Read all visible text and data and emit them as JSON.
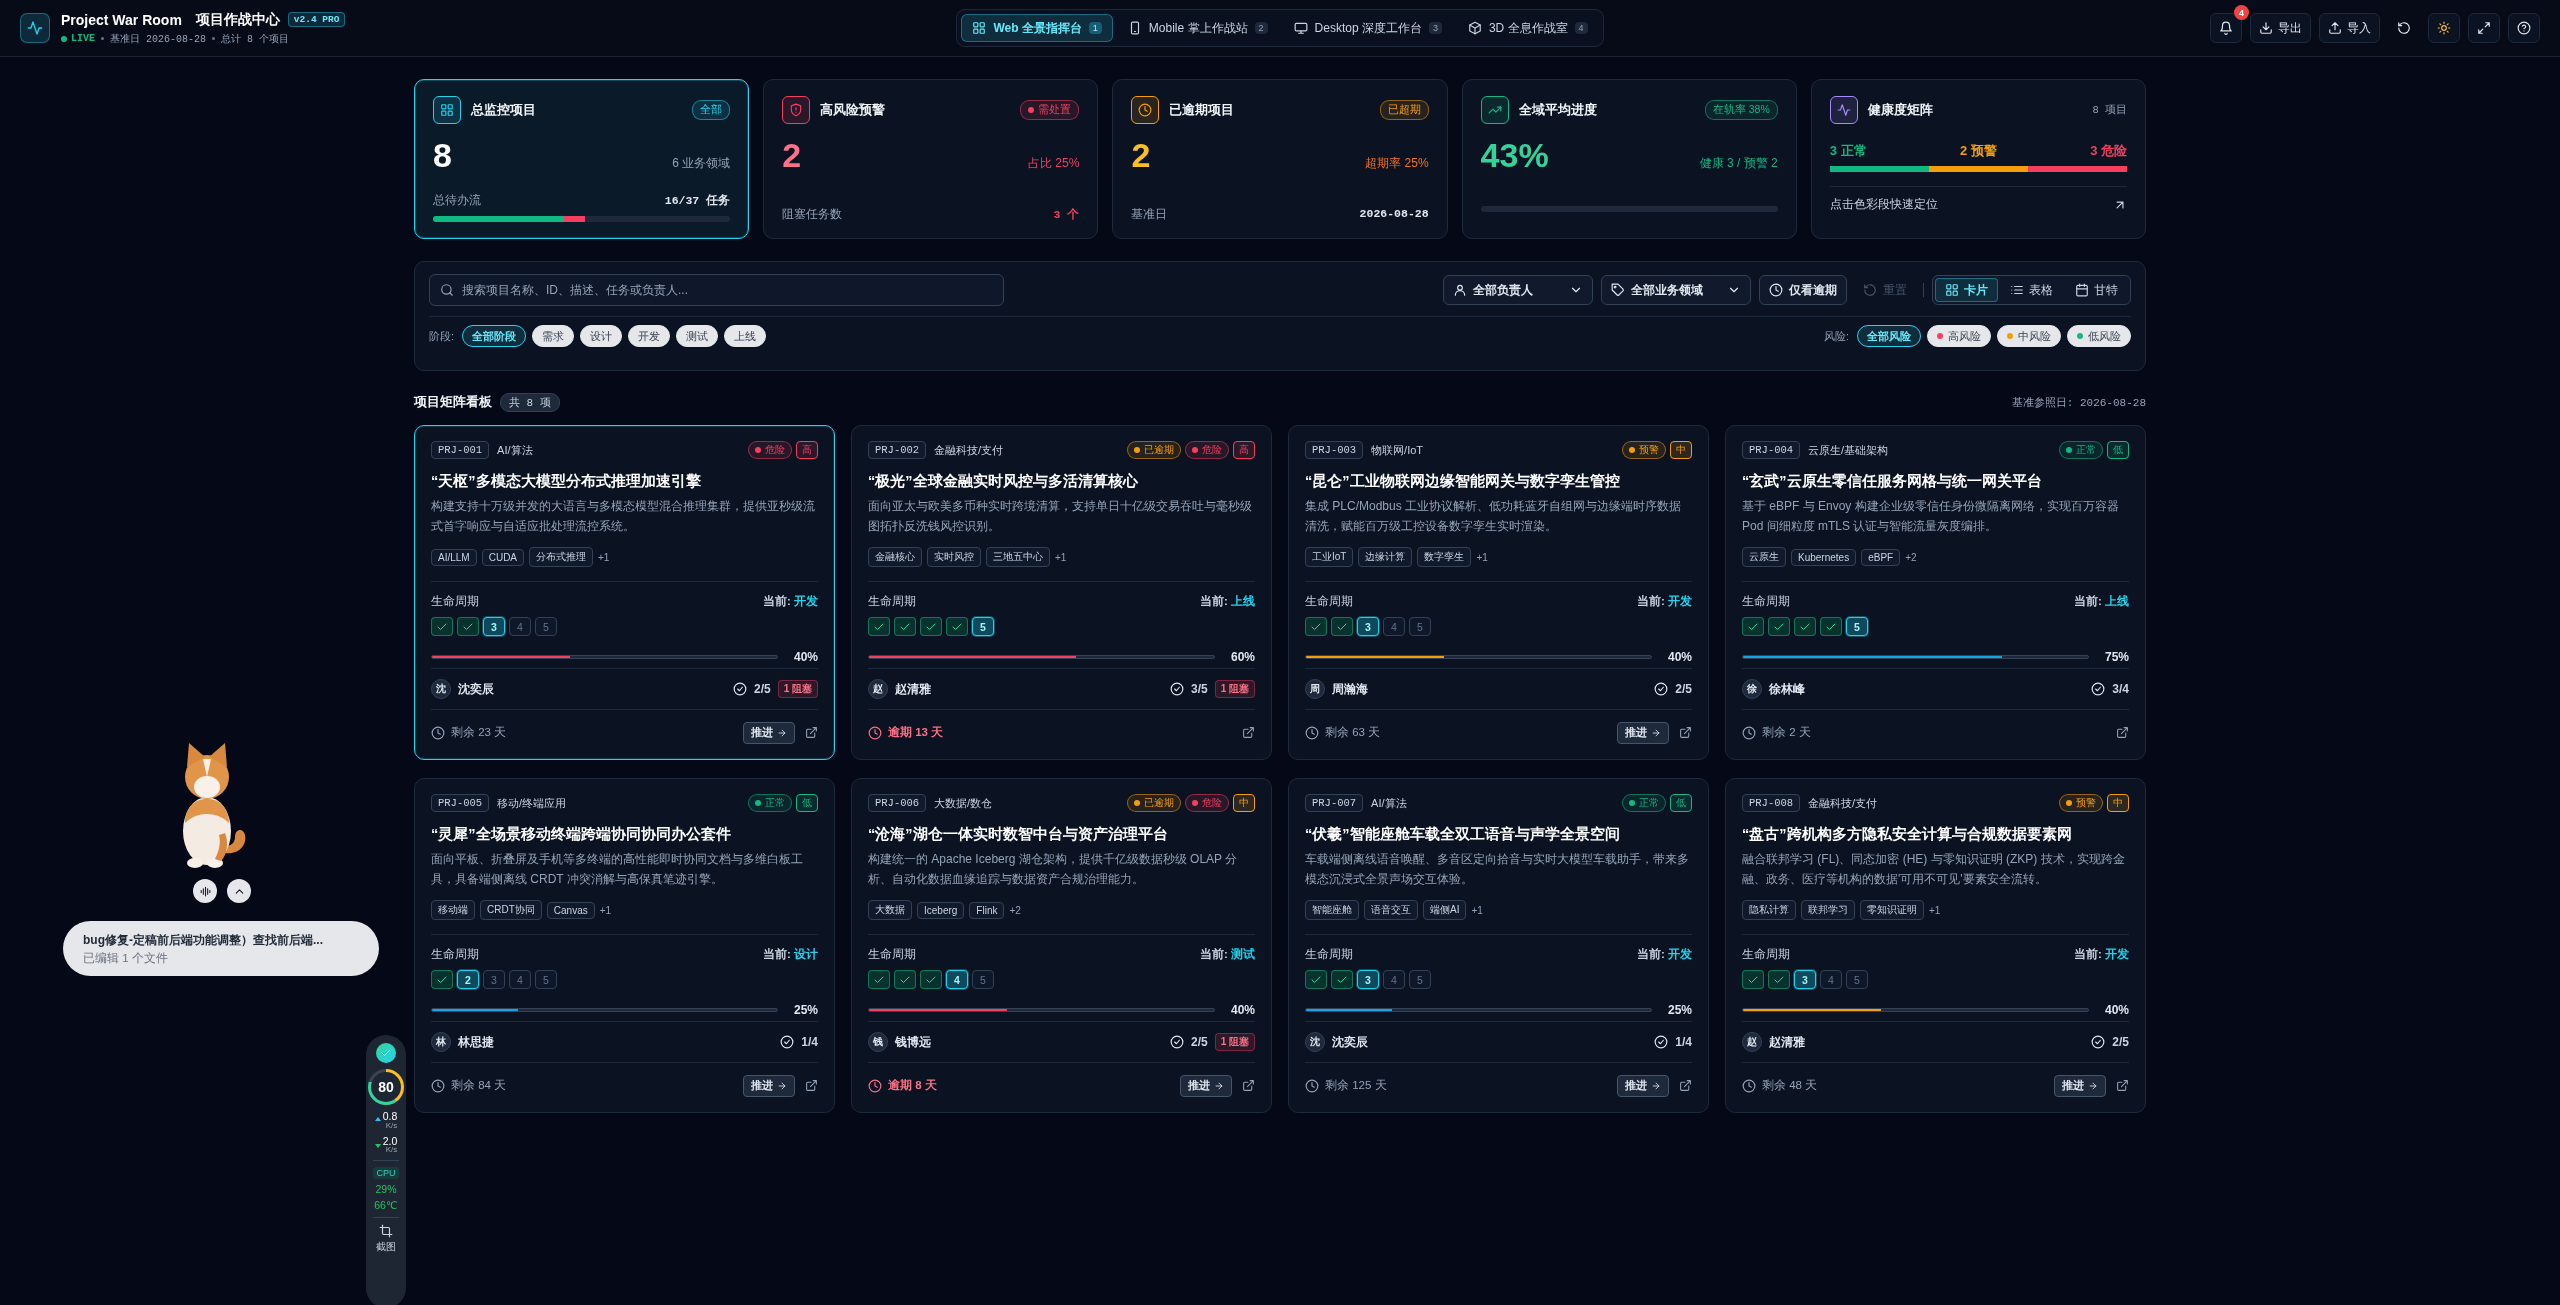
{
  "header": {
    "title": "Project War Room",
    "subtitle": "项目作战中心",
    "version": "v2.4 PRO",
    "live": "LIVE",
    "base_date": "基准日 2026-08-28",
    "total": "总计 8 个项目"
  },
  "view_tabs": [
    {
      "label": "Web 全景指挥台",
      "count": "1",
      "selected": true
    },
    {
      "label": "Mobile 掌上作战站",
      "count": "2",
      "selected": false
    },
    {
      "label": "Desktop 深度工作台",
      "count": "3",
      "selected": false
    },
    {
      "label": "3D 全息作战室",
      "count": "4",
      "selected": false
    }
  ],
  "actions": {
    "notification_count": "4",
    "export": "导出",
    "import": "导入"
  },
  "stats": [
    {
      "kind": "metric",
      "selected": true,
      "color": "#22d3ee",
      "title": "总监控项目",
      "badge": "全部",
      "badge_dot": false,
      "value": {
        "text": "8",
        "color": "#ffffff"
      },
      "note": {
        "text": "6 业务领域",
        "color": "#94a3b8"
      },
      "footer_label": "总待办流",
      "footer_value": "16/37 任务",
      "footer_emphasis": false,
      "progress": {
        "level": 0.51
      }
    },
    {
      "kind": "metric",
      "selected": false,
      "color": "#f43f5e",
      "title": "高风险预警",
      "badge": "需处置",
      "badge_dot": true,
      "value": {
        "text": "2",
        "color": "#fb7185"
      },
      "note": {
        "text": "占比 25%",
        "color": "#f43f5e"
      },
      "footer_label": "阻塞任务数",
      "footer_value": "3 个",
      "footer_emphasis": true
    },
    {
      "kind": "metric",
      "selected": false,
      "color": "#f59e0b",
      "title": "已逾期项目",
      "badge": "已超期",
      "badge_dot": false,
      "value": {
        "text": "2",
        "color": "#fbbf24"
      },
      "note": {
        "text": "超期率 25%",
        "color": "#f97316"
      },
      "footer_label": "基准日",
      "footer_value": "2026-08-28",
      "footer_emphasis": false
    },
    {
      "kind": "metric",
      "selected": false,
      "color": "#10b981",
      "title": "全域平均进度",
      "badge": "在轨率 38%",
      "badge_dot": false,
      "value": {
        "text": "43%",
        "color": "#34d399"
      },
      "note": {
        "text": "健康 3 / 预警 2",
        "color": "#10b981"
      },
      "progress_track": true
    },
    {
      "kind": "matrix",
      "selected": false,
      "color": "#a78bfa",
      "title": "健康度矩阵",
      "side": "8 项目",
      "segments": [
        {
          "label": "3 正常",
          "color": "#10b981"
        },
        {
          "label": "2 预警",
          "color": "#f59e0b"
        },
        {
          "label": "3 危险",
          "color": "#f43f5e"
        }
      ],
      "hint": "点击色彩段快速定位"
    }
  ],
  "filters": {
    "search_placeholder": "搜索项目名称、ID、描述、任务或负责人...",
    "owner": "全部负责人",
    "domain": "全部业务领域",
    "overdue_toggle": {
      "label": "仅看逾期",
      "on": false
    },
    "reset": {
      "label": "重置",
      "disabled": true
    },
    "views": [
      {
        "label": "卡片",
        "selected": true
      },
      {
        "label": "表格",
        "selected": false
      },
      {
        "label": "甘特",
        "selected": false
      }
    ],
    "stage_label": "阶段:",
    "stages": [
      {
        "label": "全部阶段",
        "selected": true
      },
      {
        "label": "需求",
        "selected": false
      },
      {
        "label": "设计",
        "selected": false
      },
      {
        "label": "开发",
        "selected": false
      },
      {
        "label": "测试",
        "selected": false
      },
      {
        "label": "上线",
        "selected": false
      }
    ],
    "risk_label": "风险:",
    "risks": [
      {
        "label": "全部风险",
        "selected": true
      },
      {
        "label": "高风险",
        "selected": false,
        "color": "#f43f5e"
      },
      {
        "label": "中风险",
        "selected": false,
        "color": "#f59e0b"
      },
      {
        "label": "低风险",
        "selected": false,
        "color": "#10b981"
      }
    ]
  },
  "board": {
    "title": "项目矩阵看板",
    "count": "共 8 项",
    "reference_date": "基准参照日: 2026-08-28"
  },
  "projects": [
    {
      "id": "PRJ-001",
      "domain": "AI/算法",
      "selected": true,
      "badges": [
        {
          "kind": "status",
          "label": "危险",
          "color": "#f43f5e"
        },
        {
          "kind": "level",
          "label": "高",
          "color": "#f43f5e"
        }
      ],
      "title": "“天枢”多模态大模型分布式推理加速引擎",
      "description": "构建支持十万级并发的大语言与多模态模型混合推理集群，提供亚秒级流式首字响应与自适应批处理流控系统。",
      "tags": [
        "AI/LLM",
        "CUDA",
        "分布式推理"
      ],
      "more_tags": "+1",
      "lifecycle_label": "生命周期",
      "current_label": "当前:",
      "current_stage": "开发",
      "steps": [
        {
          "done": true,
          "current": false
        },
        {
          "done": true,
          "current": false
        },
        {
          "done": false,
          "current": true,
          "label": "3"
        },
        {
          "done": false,
          "current": false,
          "label": "4"
        },
        {
          "done": false,
          "current": false,
          "label": "5"
        }
      ],
      "progress": {
        "level": 0.4,
        "color": "#f43f5e"
      },
      "percent": "40%",
      "avatar": "沈",
      "owner": "沈奕辰",
      "tasks": "2/5",
      "blocked": "1 阻塞",
      "footer": {
        "kind": "remaining",
        "text": "剩余 23 天"
      },
      "advance": "推进"
    },
    {
      "id": "PRJ-002",
      "domain": "金融科技/支付",
      "selected": false,
      "badges": [
        {
          "kind": "status",
          "label": "已逾期",
          "color": "#f59e0b"
        },
        {
          "kind": "status",
          "label": "危险",
          "color": "#f43f5e"
        },
        {
          "kind": "level",
          "label": "高",
          "color": "#f43f5e"
        }
      ],
      "title": "“极光”全球金融实时风控与多活清算核心",
      "description": "面向亚太与欧美多币种实时跨境清算，支持单日十亿级交易吞吐与毫秒级图拓扑反洗钱风控识别。",
      "tags": [
        "金融核心",
        "实时风控",
        "三地五中心"
      ],
      "more_tags": "+1",
      "lifecycle_label": "生命周期",
      "current_label": "当前:",
      "current_stage": "上线",
      "steps": [
        {
          "done": true,
          "current": false
        },
        {
          "done": true,
          "current": false
        },
        {
          "done": true,
          "current": false
        },
        {
          "done": true,
          "current": false
        },
        {
          "done": false,
          "current": true,
          "label": "5"
        }
      ],
      "progress": {
        "level": 0.6,
        "color": "#f43f5e"
      },
      "percent": "60%",
      "avatar": "赵",
      "owner": "赵清雅",
      "tasks": "3/5",
      "blocked": "1 阻塞",
      "footer": {
        "kind": "overdue",
        "text": "逾期 13 天"
      }
    },
    {
      "id": "PRJ-003",
      "domain": "物联网/IoT",
      "selected": false,
      "badges": [
        {
          "kind": "status",
          "label": "预警",
          "color": "#f59e0b"
        },
        {
          "kind": "level",
          "label": "中",
          "color": "#f59e0b"
        }
      ],
      "title": "“昆仑”工业物联网边缘智能网关与数字孪生管控",
      "description": "集成 PLC/Modbus 工业协议解析、低功耗蓝牙自组网与边缘端时序数据清洗，赋能百万级工控设备数字孪生实时渲染。",
      "tags": [
        "工业IoT",
        "边缘计算",
        "数字孪生"
      ],
      "more_tags": "+1",
      "lifecycle_label": "生命周期",
      "current_label": "当前:",
      "current_stage": "开发",
      "steps": [
        {
          "done": true,
          "current": false
        },
        {
          "done": true,
          "current": false
        },
        {
          "done": false,
          "current": true,
          "label": "3"
        },
        {
          "done": false,
          "current": false,
          "label": "4"
        },
        {
          "done": false,
          "current": false,
          "label": "5"
        }
      ],
      "progress": {
        "level": 0.4,
        "color": "#f59e0b"
      },
      "percent": "40%",
      "avatar": "周",
      "owner": "周瀚海",
      "tasks": "2/5",
      "footer": {
        "kind": "remaining",
        "text": "剩余 63 天"
      },
      "advance": "推进"
    },
    {
      "id": "PRJ-004",
      "domain": "云原生/基础架构",
      "selected": false,
      "badges": [
        {
          "kind": "status",
          "label": "正常",
          "color": "#10b981"
        },
        {
          "kind": "level",
          "label": "低",
          "color": "#10b981"
        }
      ],
      "title": "“玄武”云原生零信任服务网格与统一网关平台",
      "description": "基于 eBPF 与 Envoy 构建企业级零信任身份微隔离网络，实现百万容器 Pod 间细粒度 mTLS 认证与智能流量灰度编排。",
      "tags": [
        "云原生",
        "Kubernetes",
        "eBPF"
      ],
      "more_tags": "+2",
      "lifecycle_label": "生命周期",
      "current_label": "当前:",
      "current_stage": "上线",
      "steps": [
        {
          "done": true,
          "current": false
        },
        {
          "done": true,
          "current": false
        },
        {
          "done": true,
          "current": false
        },
        {
          "done": true,
          "current": false
        },
        {
          "done": false,
          "current": true,
          "label": "5"
        }
      ],
      "progress": {
        "level": 0.75,
        "color": "#0ea5e9"
      },
      "percent": "75%",
      "avatar": "徐",
      "owner": "徐林峰",
      "tasks": "3/4",
      "footer": {
        "kind": "remaining",
        "text": "剩余 2 天"
      }
    },
    {
      "id": "PRJ-005",
      "domain": "移动/终端应用",
      "selected": false,
      "badges": [
        {
          "kind": "status",
          "label": "正常",
          "color": "#10b981"
        },
        {
          "kind": "level",
          "label": "低",
          "color": "#10b981"
        }
      ],
      "title": "“灵犀”全场景移动终端跨端协同协同办公套件",
      "description": "面向平板、折叠屏及手机等多终端的高性能即时协同文档与多维白板工具，具备端侧离线 CRDT 冲突消解与高保真笔迹引擎。",
      "tags": [
        "移动端",
        "CRDT协同",
        "Canvas"
      ],
      "more_tags": "+1",
      "lifecycle_label": "生命周期",
      "current_label": "当前:",
      "current_stage": "设计",
      "steps": [
        {
          "done": true,
          "current": false
        },
        {
          "done": false,
          "current": true,
          "label": "2"
        },
        {
          "done": false,
          "current": false,
          "label": "3"
        },
        {
          "done": false,
          "current": false,
          "label": "4"
        },
        {
          "done": false,
          "current": false,
          "label": "5"
        }
      ],
      "progress": {
        "level": 0.25,
        "color": "#0ea5e9"
      },
      "percent": "25%",
      "avatar": "林",
      "owner": "林思捷",
      "tasks": "1/4",
      "footer": {
        "kind": "remaining",
        "text": "剩余 84 天"
      },
      "advance": "推进"
    },
    {
      "id": "PRJ-006",
      "domain": "大数据/数仓",
      "selected": false,
      "badges": [
        {
          "kind": "status",
          "label": "已逾期",
          "color": "#f59e0b"
        },
        {
          "kind": "status",
          "label": "危险",
          "color": "#f43f5e"
        },
        {
          "kind": "level",
          "label": "中",
          "color": "#f59e0b"
        }
      ],
      "title": "“沧海”湖仓一体实时数智中台与资产治理平台",
      "description": "构建统一的 Apache Iceberg 湖仓架构，提供千亿级数据秒级 OLAP 分析、自动化数据血缘追踪与数据资产合规治理能力。",
      "tags": [
        "大数据",
        "Iceberg",
        "Flink"
      ],
      "more_tags": "+2",
      "lifecycle_label": "生命周期",
      "current_label": "当前:",
      "current_stage": "测试",
      "steps": [
        {
          "done": true,
          "current": false
        },
        {
          "done": true,
          "current": false
        },
        {
          "done": true,
          "current": false
        },
        {
          "done": false,
          "current": true,
          "label": "4"
        },
        {
          "done": false,
          "current": false,
          "label": "5"
        }
      ],
      "progress": {
        "level": 0.4,
        "color": "#f43f5e"
      },
      "percent": "40%",
      "avatar": "钱",
      "owner": "钱博远",
      "tasks": "2/5",
      "blocked": "1 阻塞",
      "footer": {
        "kind": "overdue",
        "text": "逾期 8 天"
      },
      "advance": "推进"
    },
    {
      "id": "PRJ-007",
      "domain": "AI/算法",
      "selected": false,
      "badges": [
        {
          "kind": "status",
          "label": "正常",
          "color": "#10b981"
        },
        {
          "kind": "level",
          "label": "低",
          "color": "#10b981"
        }
      ],
      "title": "“伏羲”智能座舱车载全双工语音与声学全景空间",
      "description": "车载端侧离线语音唤醒、多音区定向拾音与实时大模型车载助手，带来多模态沉浸式全景声场交互体验。",
      "tags": [
        "智能座舱",
        "语音交互",
        "端侧AI"
      ],
      "more_tags": "+1",
      "lifecycle_label": "生命周期",
      "current_label": "当前:",
      "current_stage": "开发",
      "steps": [
        {
          "done": true,
          "current": false
        },
        {
          "done": true,
          "current": false
        },
        {
          "done": false,
          "current": true,
          "label": "3"
        },
        {
          "done": false,
          "current": false,
          "label": "4"
        },
        {
          "done": false,
          "current": false,
          "label": "5"
        }
      ],
      "progress": {
        "level": 0.25,
        "color": "#0ea5e9"
      },
      "percent": "25%",
      "avatar": "沈",
      "owner": "沈奕辰",
      "tasks": "1/4",
      "footer": {
        "kind": "remaining",
        "text": "剩余 125 天"
      },
      "advance": "推进"
    },
    {
      "id": "PRJ-008",
      "domain": "金融科技/支付",
      "selected": false,
      "badges": [
        {
          "kind": "status",
          "label": "预警",
          "color": "#f59e0b"
        },
        {
          "kind": "level",
          "label": "中",
          "color": "#f59e0b"
        }
      ],
      "title": "“盘古”跨机构多方隐私安全计算与合规数据要素网",
      "description": "融合联邦学习 (FL)、同态加密 (HE) 与零知识证明 (ZKP) 技术，实现跨金融、政务、医疗等机构的数据'可用不可见'要素安全流转。",
      "tags": [
        "隐私计算",
        "联邦学习",
        "零知识证明"
      ],
      "more_tags": "+1",
      "lifecycle_label": "生命周期",
      "current_label": "当前:",
      "current_stage": "开发",
      "steps": [
        {
          "done": true,
          "current": false
        },
        {
          "done": true,
          "current": false
        },
        {
          "done": false,
          "current": true,
          "label": "3"
        },
        {
          "done": false,
          "current": false,
          "label": "4"
        },
        {
          "done": false,
          "current": false,
          "label": "5"
        }
      ],
      "progress": {
        "level": 0.4,
        "color": "#f59e0b"
      },
      "percent": "40%",
      "avatar": "赵",
      "owner": "赵清雅",
      "tasks": "2/5",
      "footer": {
        "kind": "remaining",
        "text": "剩余 48 天"
      },
      "advance": "推进"
    }
  ],
  "assistant": {
    "task": "bug修复-定稿前后端功能调整）查找前后端...",
    "detail": "已编辑 1 个文件"
  },
  "monitor": {
    "score": "80",
    "upload": "0.8",
    "upload_unit": "K/s",
    "download": "2.0",
    "download_unit": "K/s",
    "cpu_label": "CPU",
    "cpu": "29%",
    "temp": "66℃",
    "screenshot": "截图"
  }
}
